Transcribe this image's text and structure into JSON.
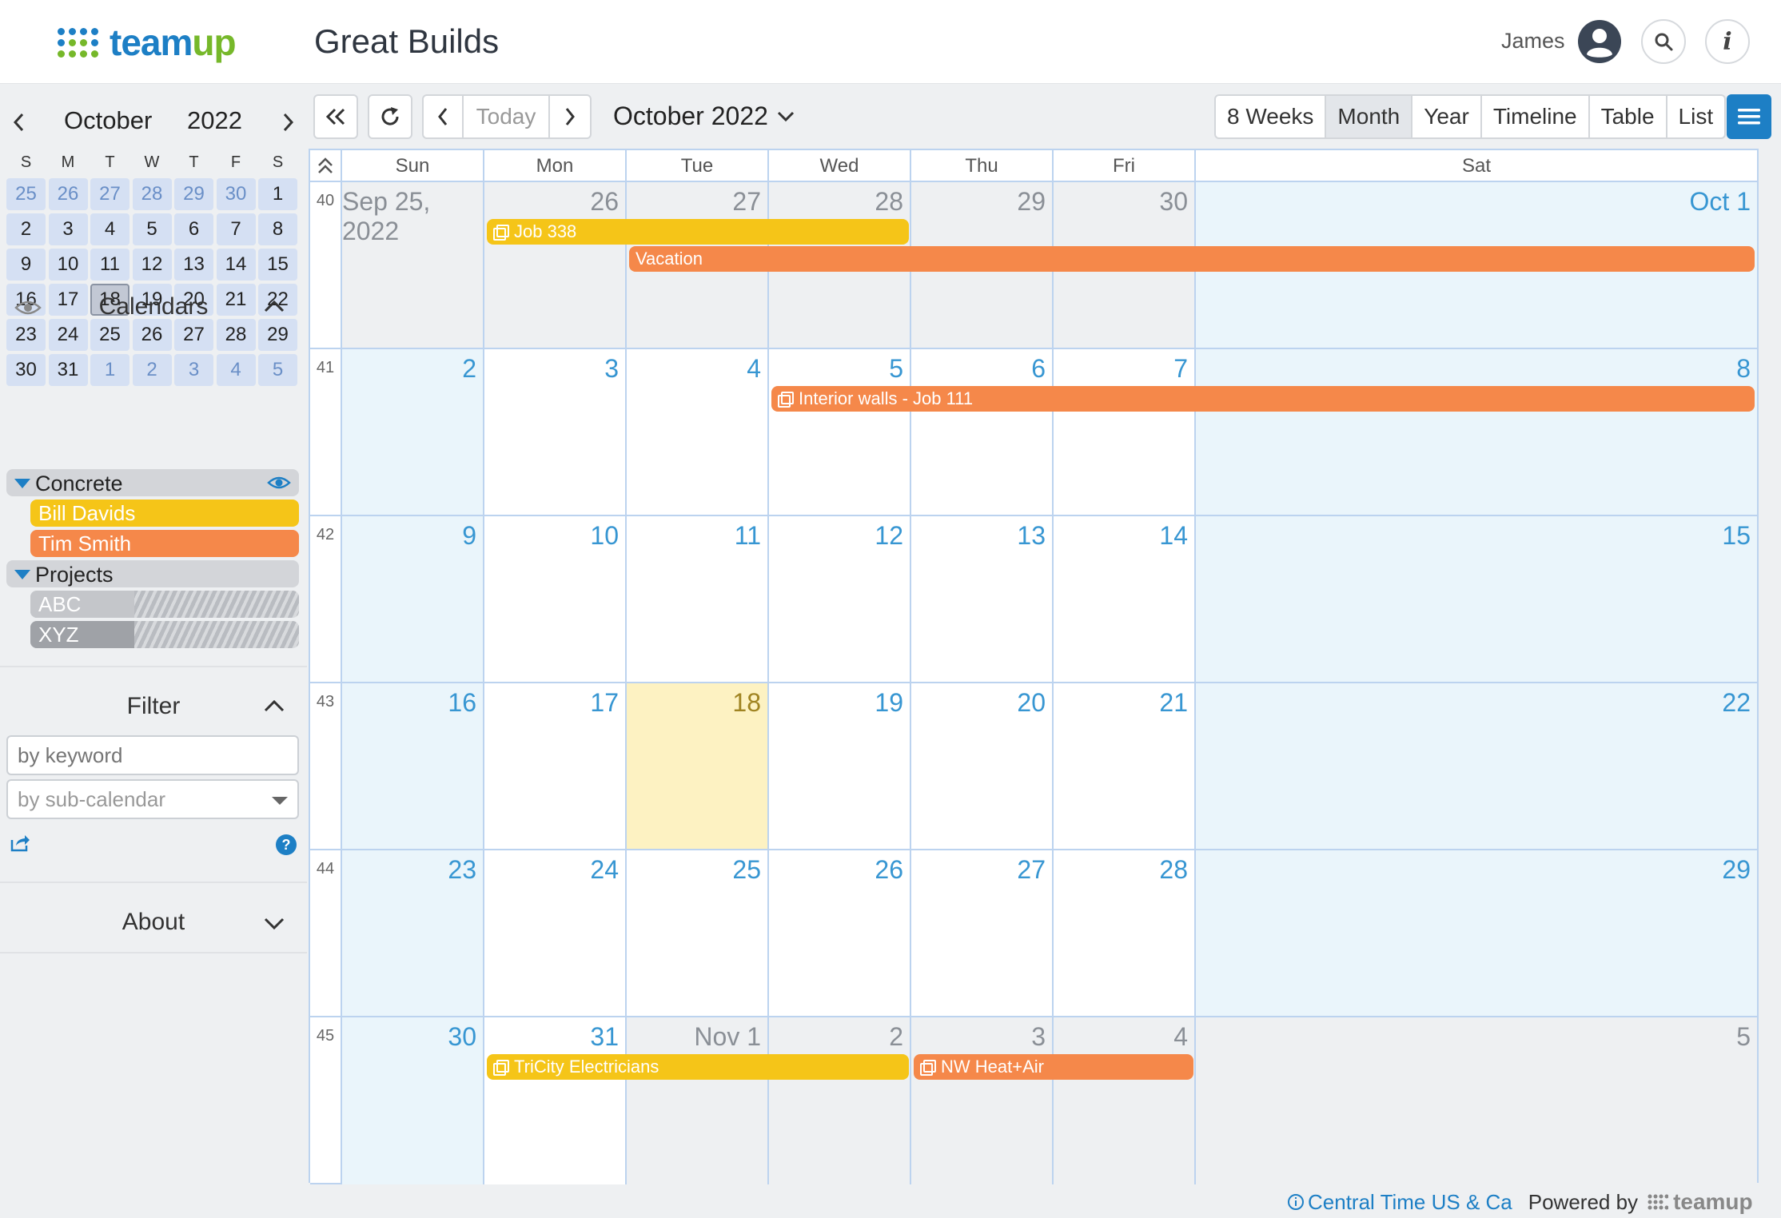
{
  "header": {
    "logo_text_a": "team",
    "logo_text_b": "up",
    "calendar_title": "Great Builds",
    "user_name": "James"
  },
  "sidebar": {
    "mini_month": "October",
    "mini_year": "2022",
    "dow": [
      "S",
      "M",
      "T",
      "W",
      "T",
      "F",
      "S"
    ],
    "days": [
      {
        "d": "25",
        "other": true
      },
      {
        "d": "26",
        "other": true
      },
      {
        "d": "27",
        "other": true
      },
      {
        "d": "28",
        "other": true
      },
      {
        "d": "29",
        "other": true
      },
      {
        "d": "30",
        "other": true
      },
      {
        "d": "1"
      },
      {
        "d": "2"
      },
      {
        "d": "3"
      },
      {
        "d": "4"
      },
      {
        "d": "5"
      },
      {
        "d": "6"
      },
      {
        "d": "7"
      },
      {
        "d": "8"
      },
      {
        "d": "9"
      },
      {
        "d": "10"
      },
      {
        "d": "11"
      },
      {
        "d": "12"
      },
      {
        "d": "13"
      },
      {
        "d": "14"
      },
      {
        "d": "15"
      },
      {
        "d": "16"
      },
      {
        "d": "17"
      },
      {
        "d": "18",
        "today": true
      },
      {
        "d": "19"
      },
      {
        "d": "20"
      },
      {
        "d": "21"
      },
      {
        "d": "22"
      },
      {
        "d": "23"
      },
      {
        "d": "24"
      },
      {
        "d": "25"
      },
      {
        "d": "26"
      },
      {
        "d": "27"
      },
      {
        "d": "28"
      },
      {
        "d": "29"
      },
      {
        "d": "30"
      },
      {
        "d": "31"
      },
      {
        "d": "1",
        "other": true
      },
      {
        "d": "2",
        "other": true
      },
      {
        "d": "3",
        "other": true
      },
      {
        "d": "4",
        "other": true
      },
      {
        "d": "5",
        "other": true
      }
    ],
    "calendars_title": "Calendars",
    "groups": {
      "concrete": "Concrete",
      "projects": "Projects"
    },
    "subcalendars": {
      "bill": {
        "label": "Bill Davids",
        "color": "#f5c518"
      },
      "tim": {
        "label": "Tim Smith",
        "color": "#f5884a"
      },
      "abc": {
        "label": "ABC",
        "color": "#c4c6ca"
      },
      "xyz": {
        "label": "XYZ",
        "color": "#9fa2a7"
      }
    },
    "filter_title": "Filter",
    "filter_keyword_placeholder": "by keyword",
    "filter_subcal_placeholder": "by sub-calendar",
    "about_title": "About"
  },
  "toolbar": {
    "today_label": "Today",
    "current_period": "October 2022",
    "views": [
      {
        "label": "8 Weeks",
        "active": false
      },
      {
        "label": "Month",
        "active": true
      },
      {
        "label": "Year",
        "active": false
      },
      {
        "label": "Timeline",
        "active": false
      },
      {
        "label": "Table",
        "active": false
      },
      {
        "label": "List",
        "active": false
      }
    ]
  },
  "grid": {
    "dow": [
      "Sun",
      "Mon",
      "Tue",
      "Wed",
      "Thu",
      "Fri",
      "Sat"
    ],
    "weeks": [
      {
        "num": "40",
        "days": [
          {
            "label": "Sep 25, 2022",
            "kind": "past"
          },
          {
            "label": "26",
            "kind": "past"
          },
          {
            "label": "27",
            "kind": "past"
          },
          {
            "label": "28",
            "kind": "past"
          },
          {
            "label": "29",
            "kind": "past"
          },
          {
            "label": "30",
            "kind": "past"
          },
          {
            "label": "Oct 1",
            "kind": "cur-weekend"
          }
        ]
      },
      {
        "num": "41",
        "days": [
          {
            "label": "2",
            "kind": "cur-weekend"
          },
          {
            "label": "3",
            "kind": "cur"
          },
          {
            "label": "4",
            "kind": "cur"
          },
          {
            "label": "5",
            "kind": "cur"
          },
          {
            "label": "6",
            "kind": "cur"
          },
          {
            "label": "7",
            "kind": "cur"
          },
          {
            "label": "8",
            "kind": "cur-weekend"
          }
        ]
      },
      {
        "num": "42",
        "days": [
          {
            "label": "9",
            "kind": "cur-weekend"
          },
          {
            "label": "10",
            "kind": "cur"
          },
          {
            "label": "11",
            "kind": "cur"
          },
          {
            "label": "12",
            "kind": "cur"
          },
          {
            "label": "13",
            "kind": "cur"
          },
          {
            "label": "14",
            "kind": "cur"
          },
          {
            "label": "15",
            "kind": "cur-weekend"
          }
        ]
      },
      {
        "num": "43",
        "days": [
          {
            "label": "16",
            "kind": "cur-weekend"
          },
          {
            "label": "17",
            "kind": "cur"
          },
          {
            "label": "18",
            "kind": "today"
          },
          {
            "label": "19",
            "kind": "cur"
          },
          {
            "label": "20",
            "kind": "cur"
          },
          {
            "label": "21",
            "kind": "cur"
          },
          {
            "label": "22",
            "kind": "cur-weekend"
          }
        ]
      },
      {
        "num": "44",
        "days": [
          {
            "label": "23",
            "kind": "cur-weekend"
          },
          {
            "label": "24",
            "kind": "cur"
          },
          {
            "label": "25",
            "kind": "cur"
          },
          {
            "label": "26",
            "kind": "cur"
          },
          {
            "label": "27",
            "kind": "cur"
          },
          {
            "label": "28",
            "kind": "cur"
          },
          {
            "label": "29",
            "kind": "cur-weekend"
          }
        ]
      },
      {
        "num": "45",
        "days": [
          {
            "label": "30",
            "kind": "cur-weekend"
          },
          {
            "label": "31",
            "kind": "cur"
          },
          {
            "label": "Nov 1",
            "kind": "next"
          },
          {
            "label": "2",
            "kind": "next"
          },
          {
            "label": "3",
            "kind": "next"
          },
          {
            "label": "4",
            "kind": "next"
          },
          {
            "label": "5",
            "kind": "next-weekend"
          }
        ]
      }
    ],
    "events": [
      {
        "title": "Job 338",
        "week": 0,
        "start": 1,
        "end": 3,
        "lane": 0,
        "color": "#f5c518",
        "icon": true
      },
      {
        "title": "Vacation",
        "week": 0,
        "start": 2,
        "end": 6,
        "lane": 1,
        "color": "#f5884a",
        "icon": false
      },
      {
        "title": "Interior walls - Job 111",
        "week": 1,
        "start": 3,
        "end": 6,
        "lane": 0,
        "color": "#f5884a",
        "icon": true
      },
      {
        "title": "TriCity Electricians",
        "week": 5,
        "start": 1,
        "end": 3,
        "lane": 0,
        "color": "#f5c518",
        "icon": true
      },
      {
        "title": "NW Heat+Air",
        "week": 5,
        "start": 4,
        "end": 5,
        "lane": 0,
        "color": "#f5884a",
        "icon": true
      }
    ]
  },
  "footer": {
    "timezone": "Central Time US & Ca",
    "powered_by": "Powered by",
    "powered_logo": "teamup"
  }
}
